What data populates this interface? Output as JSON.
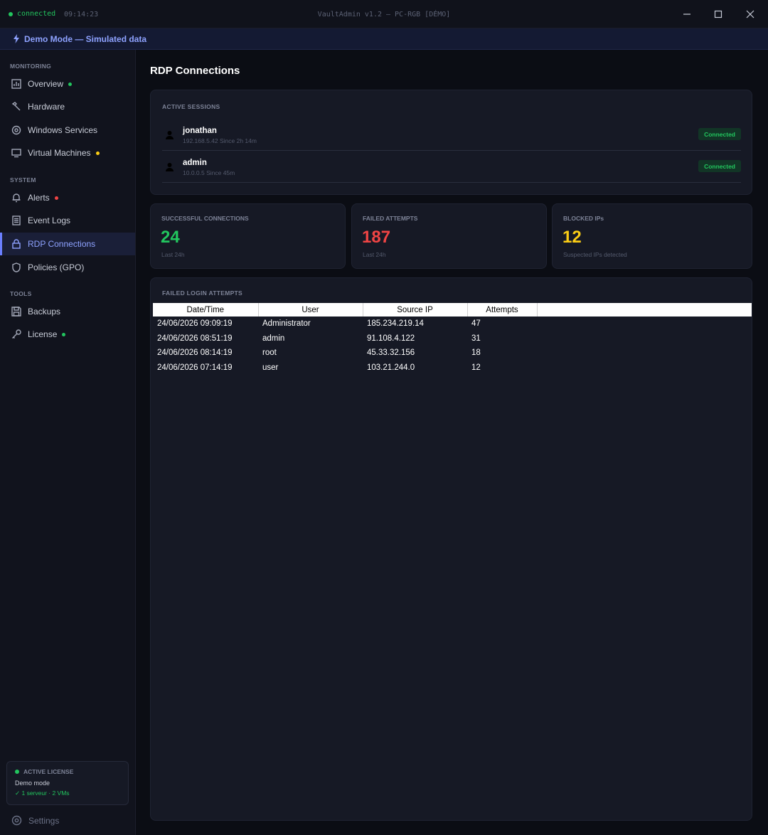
{
  "titlebar": {
    "status": "connected",
    "time": "09:14:23",
    "title": "VaultAdmin v1.2 — PC-RGB [DÉMO]"
  },
  "banner": {
    "text": "Demo Mode — Simulated data",
    "color": "#8ea2ff"
  },
  "sidebar": {
    "sections": [
      {
        "label": "MONITORING"
      },
      {
        "label": "SYSTEM"
      },
      {
        "label": "TOOLS"
      }
    ],
    "items": [
      {
        "label": "Overview",
        "icon": "chart-icon",
        "dot": "#22c55e"
      },
      {
        "label": "Hardware",
        "icon": "wrench-icon"
      },
      {
        "label": "Windows Services",
        "icon": "gear-icon"
      },
      {
        "label": "Virtual Machines",
        "icon": "monitor-icon",
        "dot": "#facc15"
      },
      {
        "label": "Alerts",
        "icon": "bell-icon",
        "dot": "#ef4444"
      },
      {
        "label": "Event Logs",
        "icon": "document-icon"
      },
      {
        "label": "RDP Connections",
        "icon": "lock-icon",
        "active": true
      },
      {
        "label": "Policies (GPO)",
        "icon": "shield-icon"
      },
      {
        "label": "Backups",
        "icon": "save-icon"
      },
      {
        "label": "License",
        "icon": "key-icon",
        "dot": "#22c55e"
      }
    ],
    "license": {
      "title": "ACTIVE LICENSE",
      "mode": "Demo mode",
      "info": "✓ 1 serveur · 2 VMs"
    },
    "settings_label": "Settings"
  },
  "main": {
    "title": "RDP Connections",
    "active_sessions": {
      "label": "ACTIVE SESSIONS",
      "sessions": [
        {
          "name": "jonathan",
          "meta": "192.168.5.42 Since 2h 14m",
          "status": "Connected"
        },
        {
          "name": "admin",
          "meta": "10.0.0.5 Since 45m",
          "status": "Connected"
        }
      ]
    },
    "stats": [
      {
        "label": "SUCCESSFUL CONNECTIONS",
        "value": "24",
        "sub": "Last 24h",
        "color": "#22c55e"
      },
      {
        "label": "FAILED ATTEMPTS",
        "value": "187",
        "sub": "Last 24h",
        "color": "#ef4444"
      },
      {
        "label": "BLOCKED IPs",
        "value": "12",
        "sub": "Suspected IPs detected",
        "color": "#facc15"
      }
    ],
    "failed": {
      "label": "FAILED LOGIN ATTEMPTS",
      "columns": [
        "Date/Time",
        "User",
        "Source IP",
        "Attempts"
      ],
      "rows": [
        [
          "24/06/2026 09:09:19",
          "Administrator",
          "185.234.219.14",
          "47"
        ],
        [
          "24/06/2026 08:51:19",
          "admin",
          "91.108.4.122",
          "31"
        ],
        [
          "24/06/2026 08:14:19",
          "root",
          "45.33.32.156",
          "18"
        ],
        [
          "24/06/2026 07:14:19",
          "user",
          "103.21.244.0",
          "12"
        ]
      ]
    }
  }
}
